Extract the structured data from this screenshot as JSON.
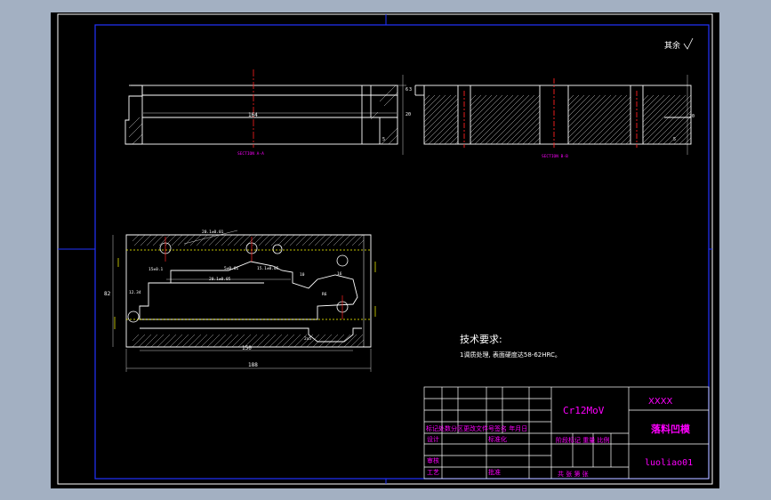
{
  "drawing": {
    "surface_finish_label": "其余",
    "section_a_label": "SECTION A-A",
    "section_b_label": "SECTION B-B",
    "tech_req_title": "技术要求:",
    "tech_req_line1": "1调质处理, 表面硬度达58-62HRC。",
    "dims": {
      "top_len": "164",
      "top_h": "20",
      "top_step": "6",
      "top_small": "5",
      "sec_h": "20",
      "sec_small": "5",
      "sec_top": "3",
      "plan_width": "188",
      "plan_inner": "150",
      "plan_height": "82",
      "d1": "20.1±0.01",
      "d2": "20.1±0.05",
      "d3": "5±0.01",
      "d4": "15.1±0.05",
      "d5": "15±0.1",
      "d6": "12.34",
      "d7": "10",
      "d8": "16",
      "d9": "R6",
      "d10": "2x5"
    },
    "colors": {
      "line": "#ffffff",
      "centerline": "#ff2020",
      "magenta": "#ff00ff",
      "blue": "#2233ff",
      "yellow": "#ffff00",
      "border": "#ffffff"
    }
  },
  "title_block": {
    "material": "Cr12MoV",
    "company": "XXXX",
    "part_name": "落料凹模",
    "drawing_no": "luoliao01",
    "labels": {
      "revision_row": "标记处数分区更改文件号签名 年月日",
      "design": "设计",
      "standardization": "标准化",
      "stage_mark": "阶段标记 重量 比例",
      "review": "审核",
      "process": "工艺",
      "approve": "批准",
      "sheets": "共 张 第 张"
    }
  }
}
